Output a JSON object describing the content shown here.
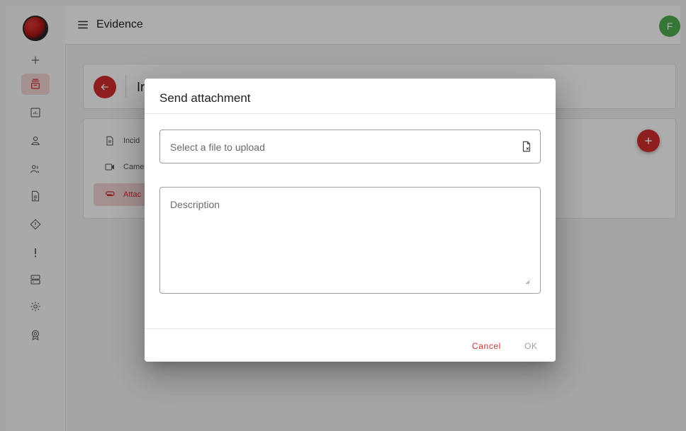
{
  "header": {
    "title": "Evidence",
    "avatar_initial": "F"
  },
  "sidebar": {
    "icons": [
      "plus-icon",
      "evidence-icon",
      "report-icon",
      "person-icon",
      "people-icon",
      "document-icon",
      "diamond-icon",
      "alert-icon",
      "server-icon",
      "settings-icon",
      "badge-icon"
    ],
    "active": "evidence-icon"
  },
  "background": {
    "title": "Ir",
    "list": [
      {
        "label": "Incid",
        "icon": "document-icon"
      },
      {
        "label": "Came",
        "icon": "video-icon"
      },
      {
        "label": "Attac",
        "icon": "attachment-icon",
        "active": true
      }
    ]
  },
  "dialog": {
    "title": "Send attachment",
    "file_placeholder": "Select a file to upload",
    "description_placeholder": "Description",
    "cancel_label": "Cancel",
    "ok_label": "OK"
  },
  "colors": {
    "accent": "#d32f2f",
    "avatar": "#4caf50",
    "overlay": "rgba(0,0,0,0.32)"
  }
}
